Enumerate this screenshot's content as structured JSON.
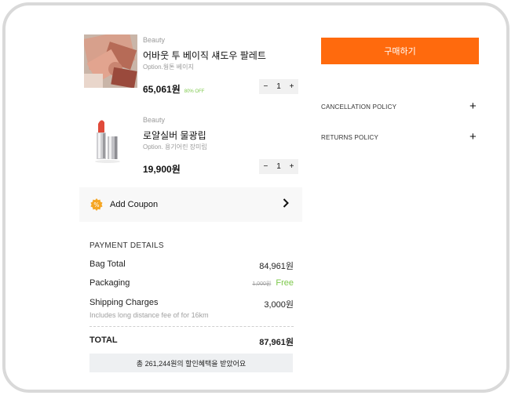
{
  "products": [
    {
      "brand": "Beauty",
      "name": "어바웃 투 베이직 섀도우 팔레트",
      "option": "Option.웜톤 베이지",
      "price": "65,061원",
      "discount": "80% OFF",
      "qty": "1"
    },
    {
      "brand": "Beauty",
      "name": "로얄실버 물광립",
      "option": "Option. 용기어린 장미립",
      "price": "19,900원",
      "discount": "",
      "qty": "1"
    }
  ],
  "stepper": {
    "minus": "−",
    "plus": "+"
  },
  "coupon": {
    "label": "Add Coupon"
  },
  "payment": {
    "heading": "PAYMENT DETAILS",
    "bag_total_label": "Bag Total",
    "bag_total": "84,961원",
    "packaging_label": "Packaging",
    "packaging_original": "1,000원",
    "packaging_value": "Free",
    "shipping_label": "Shipping Charges",
    "shipping_value": "3,000원",
    "shipping_note": "Includes long distance fee of for 16km",
    "total_label": "TOTAL",
    "total_value": "87,961원",
    "savings": "총 261,244원의 할인혜택을 받았어요"
  },
  "buy_button": "구매하기",
  "policies": [
    {
      "label": "CANCELLATION POLICY"
    },
    {
      "label": "RETURNS POLICY"
    }
  ],
  "colors": {
    "accent": "#ff6a0d",
    "discount": "#7cc84a",
    "free": "#7cc84a",
    "coupon_icon": "#f5a623"
  }
}
